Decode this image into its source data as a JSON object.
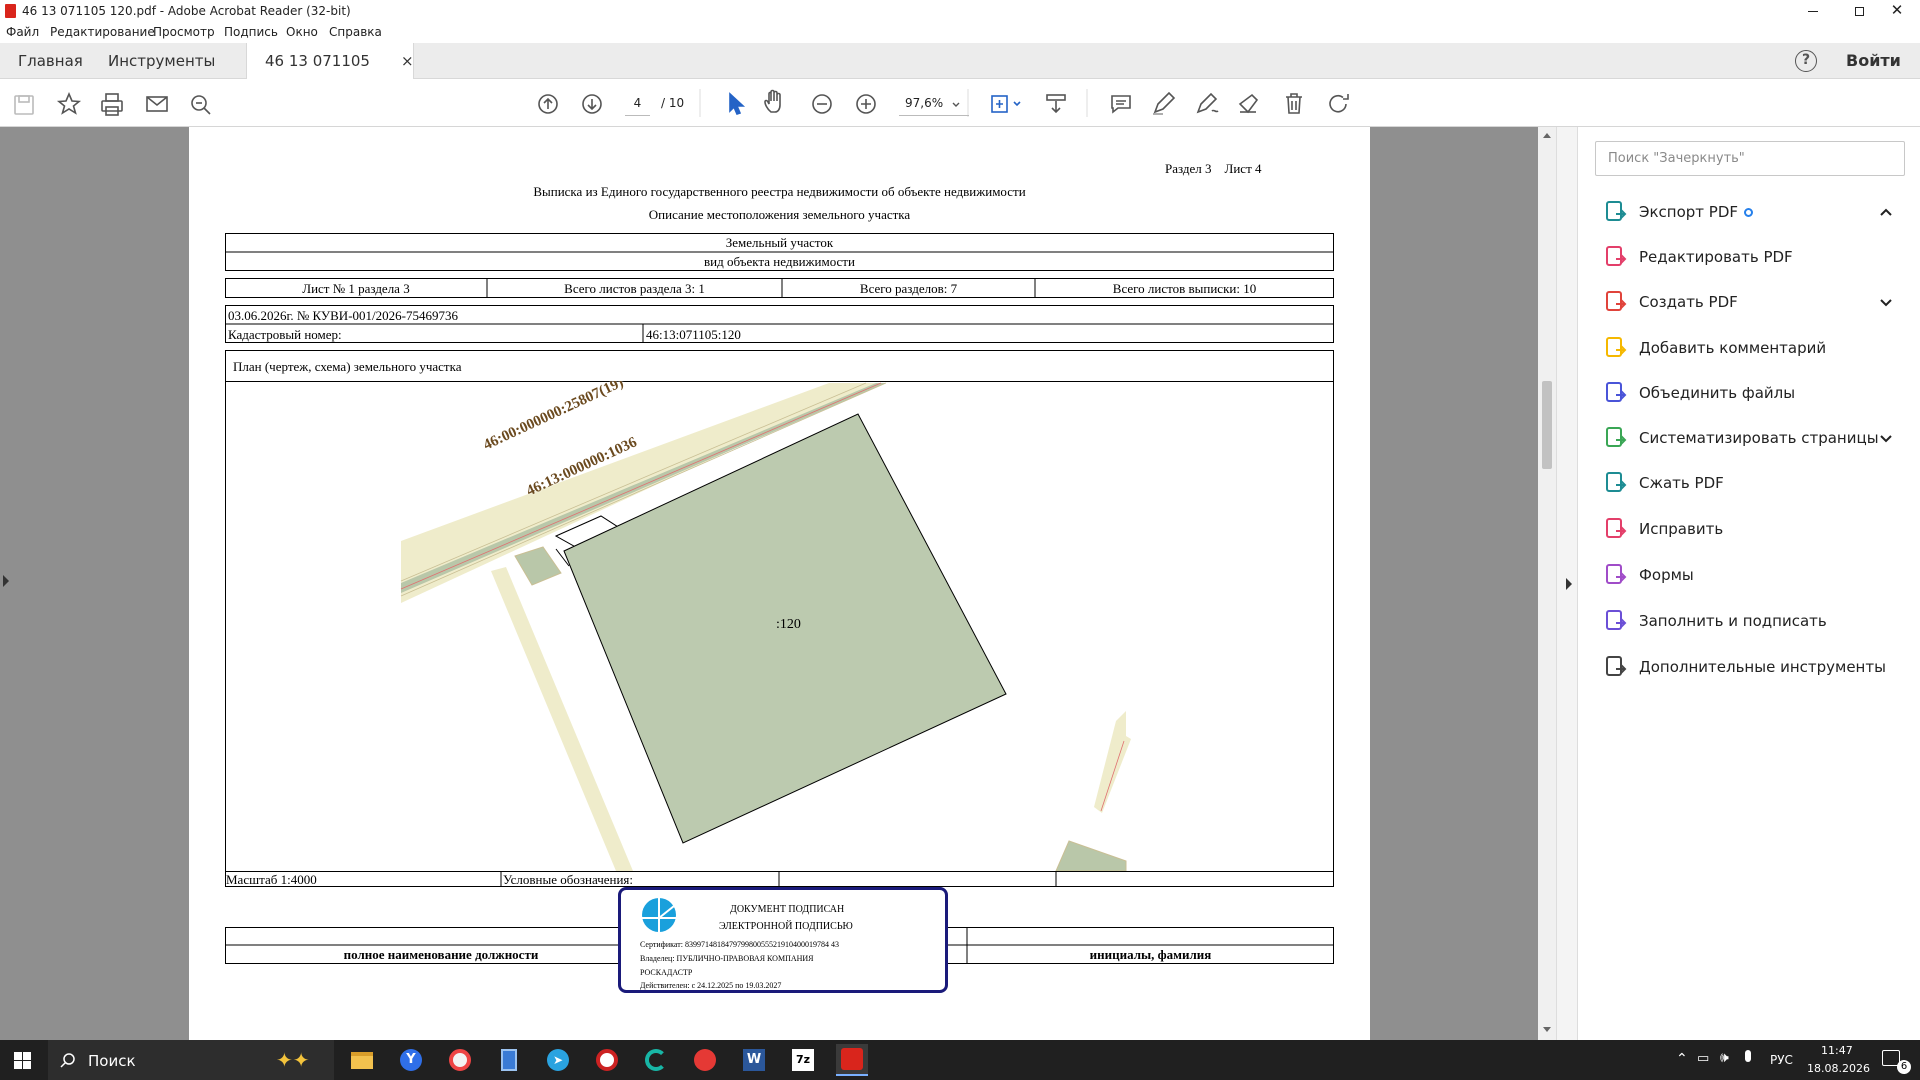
{
  "window": {
    "title": "46 13 071105 120.pdf - Adobe Acrobat Reader (32-bit)"
  },
  "menu": [
    "Файл",
    "Редактирование",
    "Просмотр",
    "Подпись",
    "Окно",
    "Справка"
  ],
  "tabs": {
    "home": "Главная",
    "tools": "Инструменты",
    "doc": "46 13 071105 120....",
    "close": "×",
    "signin": "Войти"
  },
  "toolbar": {
    "page_current": "4",
    "page_total": "/ 10",
    "zoom": "97,6%"
  },
  "search": {
    "placeholder": "Поиск \"Зачеркнуть\""
  },
  "tools_panel": [
    {
      "label": "Экспорт PDF",
      "icon": "export-pdf-icon",
      "color": "#1d8c93"
    },
    {
      "label": "Редактировать PDF",
      "icon": "edit-pdf-icon",
      "color": "#e33f6a"
    },
    {
      "label": "Создать PDF",
      "icon": "create-pdf-icon",
      "color": "#e0433b"
    },
    {
      "label": "Добавить комментарий",
      "icon": "comment-icon",
      "color": "#f5b800"
    },
    {
      "label": "Объединить файлы",
      "icon": "combine-icon",
      "color": "#4a54d8"
    },
    {
      "label": "Систематизировать страницы",
      "icon": "organize-icon",
      "color": "#3aa655"
    },
    {
      "label": "Сжать PDF",
      "icon": "compress-icon",
      "color": "#1d8c93"
    },
    {
      "label": "Исправить",
      "icon": "redact-icon",
      "color": "#e33f6a"
    },
    {
      "label": "Формы",
      "icon": "forms-icon",
      "color": "#a04cc8"
    },
    {
      "label": "Заполнить и подписать",
      "icon": "fill-sign-icon",
      "color": "#6b4fd6"
    },
    {
      "label": "Дополнительные инструменты",
      "icon": "more-tools-icon",
      "color": "#444444"
    }
  ],
  "doc": {
    "section_sheet": "Раздел 3    Лист 4",
    "title": "Выписка из Единого государственного реестра недвижимости об объекте недвижимости",
    "subtitle": "Описание местоположения земельного участка",
    "object_type": "Земельный участок",
    "object_kind_label": "вид объекта недвижимости",
    "sheet_no": "Лист № 1 раздела 3",
    "sheets_in_section": "Всего листов раздела 3: 1",
    "sections_total": "Всего разделов: 7",
    "sheets_total": "Всего листов выписки: 10",
    "date_number": "03.06.2026г. № КУВИ-001/2026-75469736",
    "cadastral_label": "Кадастровый номер:",
    "cadastral_value": "46:13:071105:120",
    "plan_label": "План (чертеж, схема) земельного участка",
    "map_label1": "46:00:000000:25807(19)",
    "map_label2": "46:13:000000:1036",
    "parcel_label": ":120",
    "scale": "Масштаб 1:4000",
    "legend": "Условные обозначения:",
    "position_label": "полное наименование должности",
    "initials_label": "инициалы, фамилия"
  },
  "stamp": {
    "line1": "ДОКУМЕНТ ПОДПИСАН",
    "line2": "ЭЛЕКТРОННОЙ ПОДПИСЬЮ",
    "cert": "Сертификат: 839971481847979980055521910400019784 43",
    "owner": "Владелец: ПУБЛИЧНО-ПРАВОВАЯ КОМПАНИЯ",
    "owner2": "РОСКАДАСТР",
    "valid": "Действителен: с 24.12.2025 по 19.03.2027"
  },
  "taskbar": {
    "search": "Поиск",
    "lang": "РУС",
    "time": "11:47",
    "date": "18.08.2026",
    "notif": "6"
  }
}
